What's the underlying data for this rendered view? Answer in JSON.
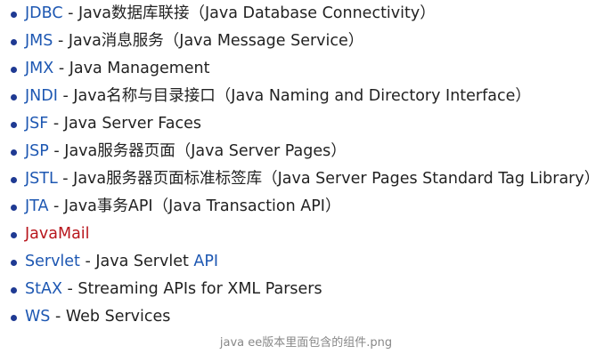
{
  "items": [
    {
      "term": "JDBC",
      "sep": " - ",
      "desc": "Java数据库联接（Java Database Connectivity）",
      "desc_link": "",
      "term_color": "blue"
    },
    {
      "term": "JMS",
      "sep": " - ",
      "desc": "Java消息服务（Java Message Service）",
      "desc_link": "",
      "term_color": "blue"
    },
    {
      "term": "JMX",
      "sep": " - ",
      "desc": "Java Management",
      "desc_link": "",
      "term_color": "blue"
    },
    {
      "term": "JNDI",
      "sep": " - ",
      "desc": "Java名称与目录接口（Java Naming and Directory Interface）",
      "desc_link": "",
      "term_color": "blue"
    },
    {
      "term": "JSF",
      "sep": " - ",
      "desc": "Java Server Faces",
      "desc_link": "",
      "term_color": "blue"
    },
    {
      "term": "JSP",
      "sep": " - ",
      "desc": "Java服务器页面（Java Server Pages）",
      "desc_link": "",
      "term_color": "blue"
    },
    {
      "term": "JSTL",
      "sep": " - ",
      "desc": "Java服务器页面标准标签库（Java Server Pages Standard Tag Library）",
      "desc_link": "",
      "term_color": "blue"
    },
    {
      "term": "JTA",
      "sep": " - ",
      "desc": "Java事务API（Java Transaction API）",
      "desc_link": "",
      "term_color": "blue"
    },
    {
      "term": "JavaMail",
      "sep": "",
      "desc": "",
      "desc_link": "",
      "term_color": "red"
    },
    {
      "term": "Servlet",
      "sep": " - ",
      "desc": "Java Servlet ",
      "desc_link": "API",
      "term_color": "blue"
    },
    {
      "term": "StAX",
      "sep": " - ",
      "desc": "Streaming APIs for XML Parsers",
      "desc_link": "",
      "term_color": "blue"
    },
    {
      "term": "WS",
      "sep": " - ",
      "desc": "Web Services",
      "desc_link": "",
      "term_color": "blue"
    }
  ],
  "caption": "java ee版本里面包含的组件.png",
  "colors": {
    "link_blue": "#1d57b2",
    "link_red": "#b8161d",
    "text": "#222222",
    "bullet": "#1f3a93",
    "caption": "#888888"
  }
}
